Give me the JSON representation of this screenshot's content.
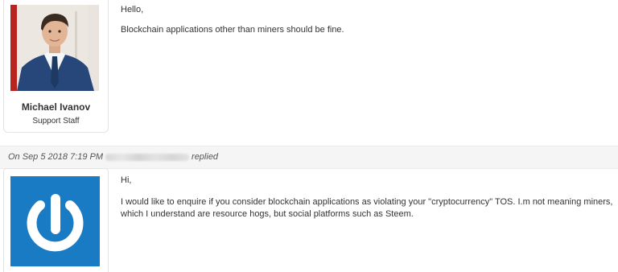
{
  "staff_post": {
    "greeting": "Hello,",
    "message": "Blockchain applications other than miners should be fine.",
    "author_name": "Michael Ivanov",
    "author_role": "Support Staff"
  },
  "reply_header": {
    "date": "On Sep 5 2018 7:19 PM",
    "verb": "replied"
  },
  "customer_post": {
    "greeting": "Hi,",
    "message": "I would like to enquire if you consider blockchain applications as violating your \"cryptocurrency\" TOS. I.m not meaning miners, which I understand are resource hogs, but social platforms such as Steem.",
    "avatar_icon": "power-icon",
    "avatar_color": "#1a7bc5"
  }
}
